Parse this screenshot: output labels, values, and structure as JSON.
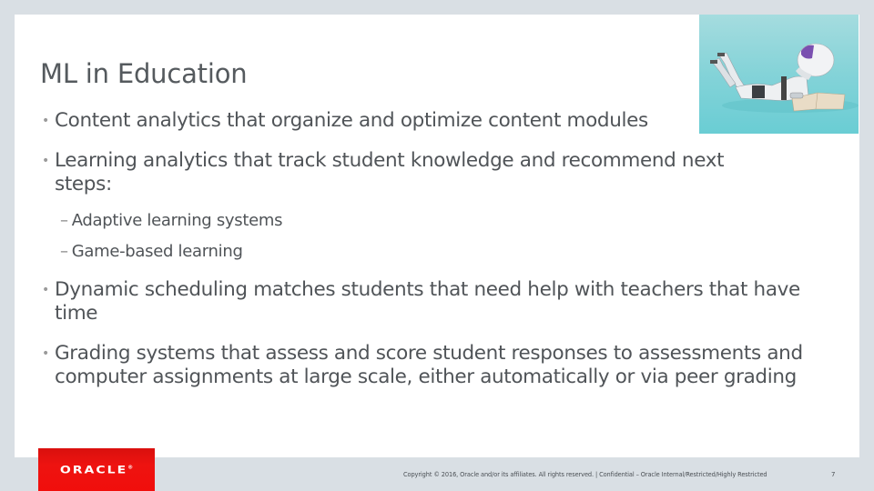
{
  "slide": {
    "title": "ML in Education",
    "bullets": [
      {
        "marker": "•",
        "text": "Content analytics that organize and optimize content modules"
      },
      {
        "marker": "•",
        "text": "Learning analytics that track student knowledge and recommend next steps:",
        "sub_items": [
          {
            "marker": "–",
            "text": "Adaptive learning systems"
          },
          {
            "marker": "–",
            "text": "Game-based learning"
          }
        ]
      },
      {
        "marker": "•",
        "text": "Dynamic scheduling matches students that need help with teachers that have time"
      },
      {
        "marker": "•",
        "text": "Grading systems that assess and score student responses to assessments and computer assignments at large scale, either automatically or via peer grading"
      }
    ],
    "image": {
      "icon": "robot-reading-book-image",
      "alt": "Robot lying down reading a book"
    }
  },
  "footer": {
    "logo_text": "ORACLE",
    "logo_mark": "®",
    "copyright": "Copyright © 2016, Oracle and/or its affiliates. All rights reserved.  |  Confidential – Oracle Internal/Restricted/Highly Restricted",
    "page_number": "7"
  },
  "colors": {
    "background": "#d9dfe4",
    "slide": "#ffffff",
    "text": "#505458",
    "bullet": "#9a9a9a",
    "oracle_red": "#ee1310"
  }
}
